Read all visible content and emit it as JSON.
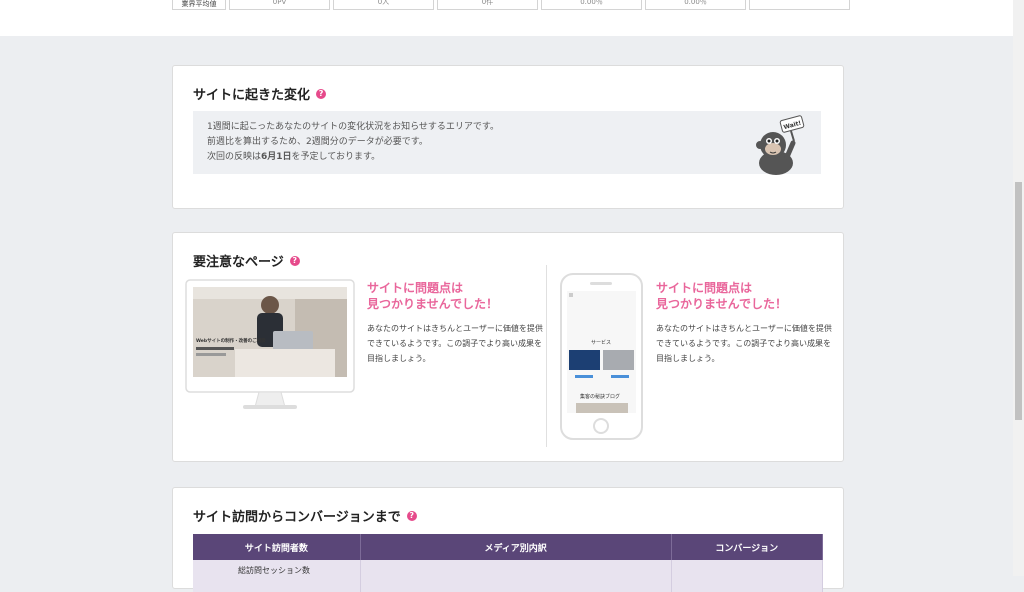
{
  "top_row": {
    "label": "業界平均値",
    "cells": [
      "0PV",
      "0人",
      "0件",
      "0.00％",
      "0.00％",
      ""
    ]
  },
  "change_section": {
    "title": "サイトに起きた変化",
    "lines": [
      "1週間に起こったあなたのサイトの変化状況をお知らせするエリアです。",
      "前週比を算出するため、2週間分のデータが必要です。"
    ],
    "line3_prefix": "次回の反映は",
    "line3_date": "6月1日",
    "line3_suffix": "を予定しております。",
    "mascot_sign": "Wait!"
  },
  "attention_section": {
    "title": "要注意なページ",
    "pc": {
      "headline_1": "サイトに問題点は",
      "headline_2": "見つかりませんでした！",
      "desc": "あなたのサイトはきちんとユーザーに価値を提供できているようです。この調子でより高い成果を目指しましょう。",
      "screen_caption": "Webサイトの制作・改善のご相談"
    },
    "sp": {
      "headline_1": "サイトに問題点は",
      "headline_2": "見つかりませんでした！",
      "desc": "あなたのサイトはきちんとユーザーに価値を提供できているようです。この調子でより高い成果を目指しましょう。",
      "screen_service": "サービス",
      "screen_blog": "集客の秘訣ブログ"
    }
  },
  "conversion_section": {
    "title": "サイト訪問からコンバージョンまで",
    "headers": [
      "サイト訪問者数",
      "メディア別内訳",
      "コンバージョン"
    ],
    "row_label": "総訪問セッション数"
  },
  "colors": {
    "accent_pink": "#e9669b",
    "help_icon": "#e64a8b",
    "table_header": "#5a4678"
  }
}
